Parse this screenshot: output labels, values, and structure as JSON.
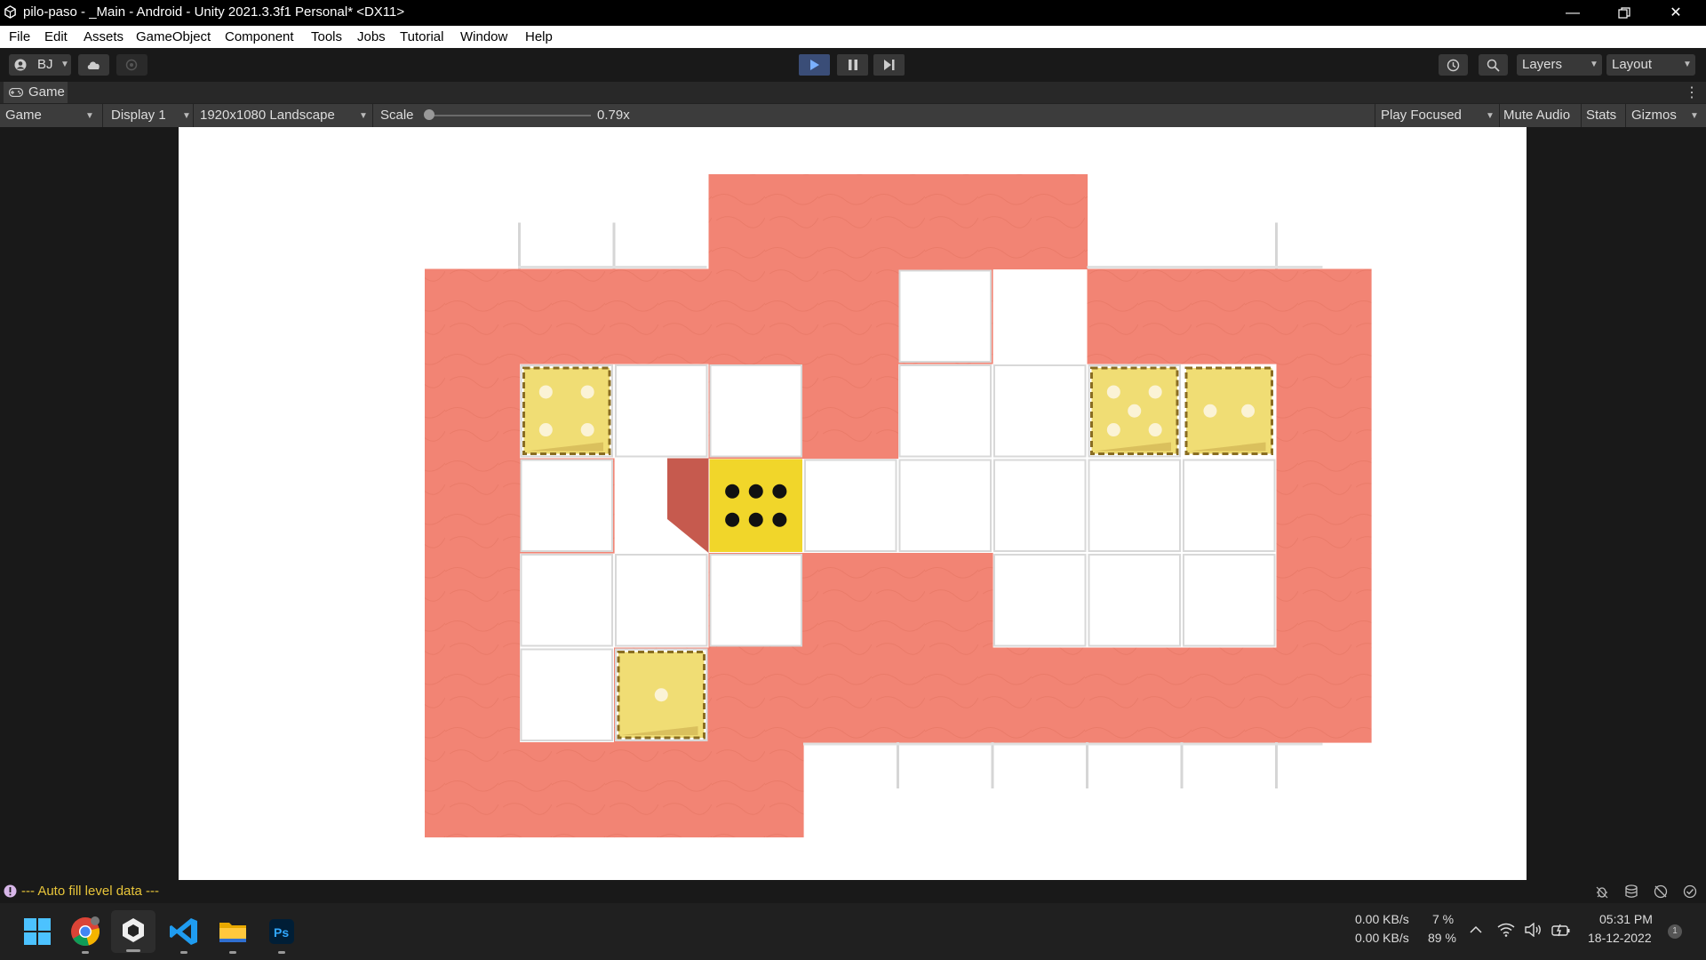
{
  "window": {
    "title": "pilo-paso - _Main - Android - Unity 2021.3.3f1 Personal* <DX11>"
  },
  "menu": [
    "File",
    "Edit",
    "Assets",
    "GameObject",
    "Component",
    "Tools",
    "Jobs",
    "Tutorial",
    "Window",
    "Help"
  ],
  "toolbar": {
    "account_label": "BJ",
    "layers_label": "Layers",
    "layout_label": "Layout"
  },
  "game_tab": {
    "tab_label": "Game",
    "view_select": "Game",
    "display_select": "Display 1",
    "resolution_select": "1920x1080 Landscape",
    "scale_label": "Scale",
    "scale_value": "0.79x",
    "scale_level": 0.0,
    "play_focused": "Play Focused",
    "mute_audio": "Mute Audio",
    "stats": "Stats",
    "gizmos": "Gizmos"
  },
  "game_board": {
    "dice": [
      {
        "pips": 4,
        "style": "target"
      },
      {
        "pips": 5,
        "style": "target"
      },
      {
        "pips": 2,
        "style": "target"
      },
      {
        "pips": 1,
        "style": "target"
      },
      {
        "pips": 6,
        "style": "player"
      }
    ],
    "colors": {
      "floor": "#f28474",
      "tile": "#ffffff",
      "die_target": "#f0dd74",
      "die_player": "#f1d62a"
    }
  },
  "status": {
    "message": "--- Auto fill level data ---"
  },
  "taskbar": {
    "apps": [
      "windows-start-icon",
      "chrome-icon",
      "unity-icon",
      "vscode-icon",
      "file-explorer-icon",
      "photoshop-icon"
    ],
    "net_up": "0.00 KB/s",
    "net_down": "0.00 KB/s",
    "cpu": "7 %",
    "mem": "89 %",
    "time": "05:31 PM",
    "date": "18-12-2022",
    "notification_count": "1"
  }
}
